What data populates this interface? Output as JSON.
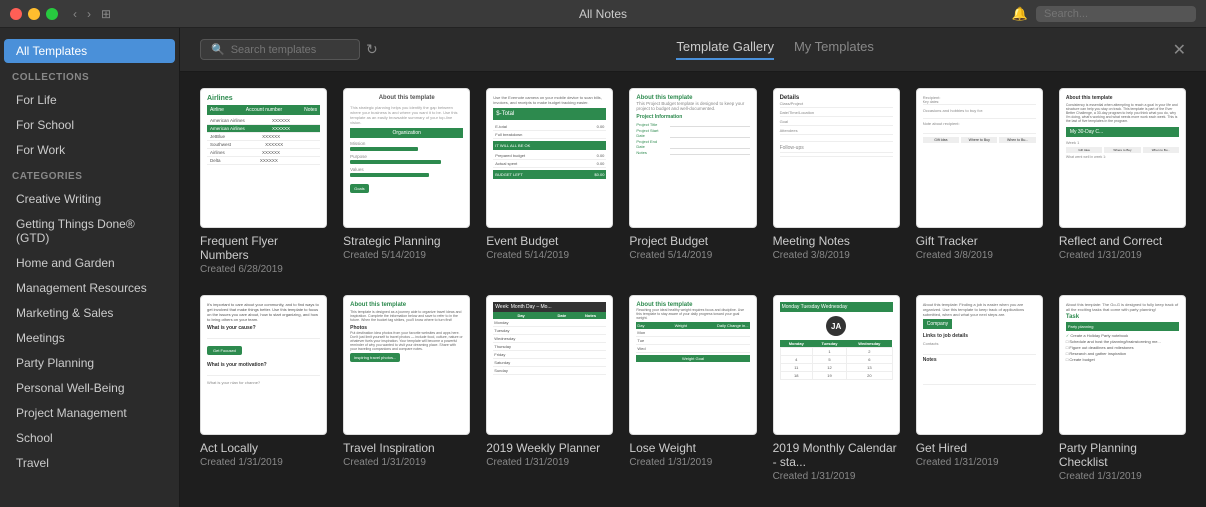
{
  "titleBar": {
    "title": "All Notes",
    "searchPlaceholder": "Search..."
  },
  "searchTemplates": {
    "placeholder": "Search templates"
  },
  "tabs": [
    {
      "id": "template-gallery",
      "label": "Template Gallery",
      "active": true
    },
    {
      "id": "my-templates",
      "label": "My Templates",
      "active": false
    }
  ],
  "sidebar": {
    "allTemplates": "All Templates",
    "collections": {
      "title": "COLLECTIONS",
      "items": [
        {
          "id": "for-life",
          "label": "For Life"
        },
        {
          "id": "for-school",
          "label": "For School"
        },
        {
          "id": "for-work",
          "label": "For Work"
        }
      ]
    },
    "categories": {
      "title": "CATEGORIES",
      "items": [
        {
          "id": "creative-writing",
          "label": "Creative Writing"
        },
        {
          "id": "gtd",
          "label": "Getting Things Done® (GTD)"
        },
        {
          "id": "home-garden",
          "label": "Home and Garden"
        },
        {
          "id": "management",
          "label": "Management Resources"
        },
        {
          "id": "marketing",
          "label": "Marketing & Sales"
        },
        {
          "id": "meetings",
          "label": "Meetings"
        },
        {
          "id": "party-planning",
          "label": "Party Planning"
        },
        {
          "id": "personal-wellbeing",
          "label": "Personal Well-Being"
        },
        {
          "id": "project-management",
          "label": "Project Management"
        },
        {
          "id": "school",
          "label": "School"
        },
        {
          "id": "travel",
          "label": "Travel"
        }
      ]
    }
  },
  "templates": {
    "row1": [
      {
        "id": "frequent-flyer",
        "name": "Frequent Flyer Numbers",
        "date": "Created 6/28/2019"
      },
      {
        "id": "strategic-planning",
        "name": "Strategic Planning",
        "date": "Created 5/14/2019"
      },
      {
        "id": "event-budget",
        "name": "Event Budget",
        "date": "Created 5/14/2019"
      },
      {
        "id": "project-budget",
        "name": "Project Budget",
        "date": "Created 5/14/2019"
      },
      {
        "id": "meeting-notes",
        "name": "Meeting Notes",
        "date": "Created 3/8/2019"
      },
      {
        "id": "gift-tracker",
        "name": "Gift Tracker",
        "date": "Created 3/8/2019"
      },
      {
        "id": "reflect-correct",
        "name": "Reflect and Correct",
        "date": "Created 1/31/2019"
      }
    ],
    "row2": [
      {
        "id": "act-locally",
        "name": "Act Locally",
        "date": "Created 1/31/2019"
      },
      {
        "id": "travel-inspiration",
        "name": "Travel Inspiration",
        "date": "Created 1/31/2019"
      },
      {
        "id": "weekly-planner",
        "name": "2019 Weekly Planner",
        "date": "Created 1/31/2019"
      },
      {
        "id": "lose-weight",
        "name": "Lose Weight",
        "date": "Created 1/31/2019"
      },
      {
        "id": "monthly-calendar",
        "name": "2019 Monthly Calendar - sta...",
        "date": "Created 1/31/2019"
      },
      {
        "id": "get-hired",
        "name": "Get Hired",
        "date": "Created 1/31/2019"
      },
      {
        "id": "party-planning-checklist",
        "name": "Party Planning Checklist",
        "date": "Created 1/31/2019"
      }
    ]
  }
}
